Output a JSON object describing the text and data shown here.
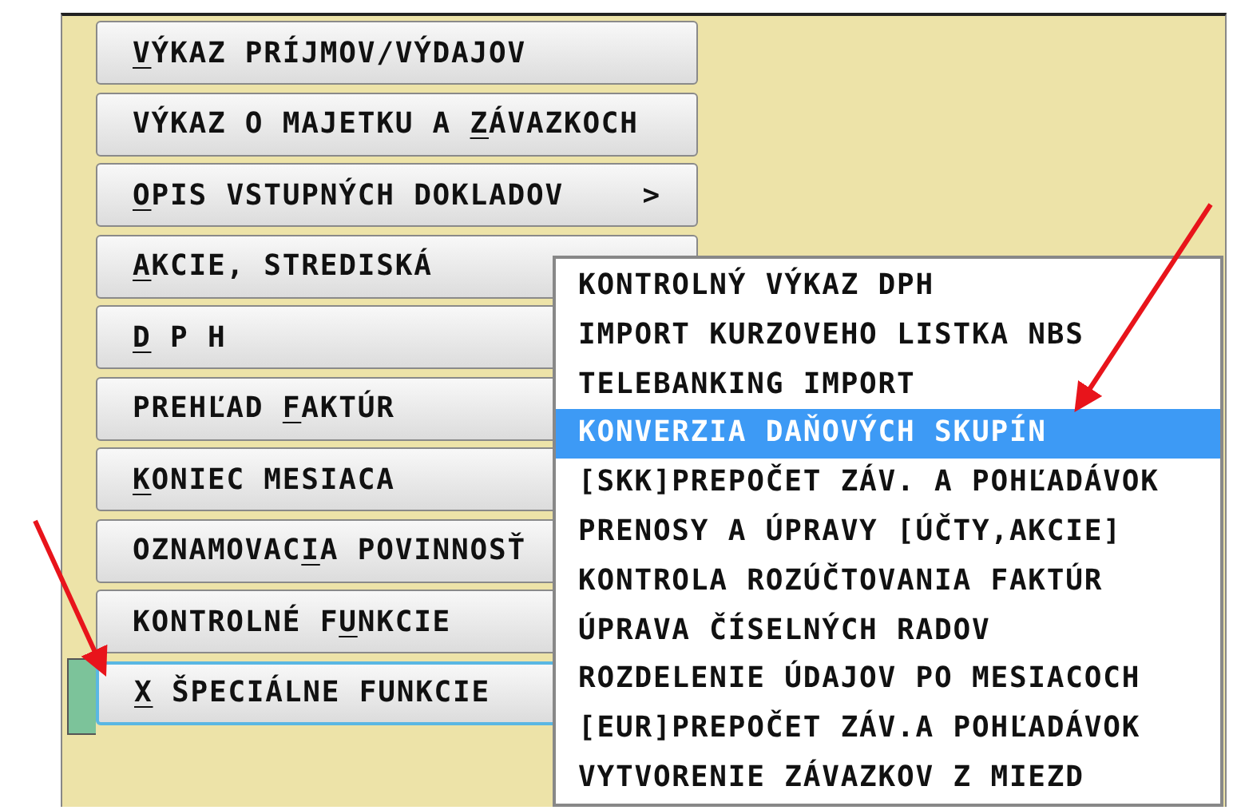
{
  "main_menu": [
    {
      "key": "V",
      "after": "ÝKAZ PRÍJMOV/VÝDAJOV",
      "selected": false
    },
    {
      "before": "VÝKAZ O MAJETKU A ",
      "key": "Z",
      "after": "ÁVAZKOCH",
      "selected": false
    },
    {
      "key": "O",
      "after": "PIS VSTUPNÝCH DOKLADOV",
      "submenu_mark": ">",
      "selected": false
    },
    {
      "key": "A",
      "after": "KCIE, STREDISKÁ",
      "selected": false
    },
    {
      "key": "D",
      "after": " P H",
      "selected": false
    },
    {
      "before": "PREHĽAD ",
      "key": "F",
      "after": "AKTÚR",
      "selected": false
    },
    {
      "key": "K",
      "after": "ONIEC MESIACA",
      "selected": false
    },
    {
      "before": "OZNAMOVAC",
      "key": "I",
      "after": "A POVINNOSŤ",
      "selected": false
    },
    {
      "before": "KONTROLNÉ F",
      "key": "U",
      "after": "NKCIE",
      "selected": false
    },
    {
      "key": "X",
      "after": " ŠPECIÁLNE FUNKCIE",
      "selected": true
    }
  ],
  "submenu": [
    {
      "label": "KONTROLNÝ VÝKAZ DPH",
      "selected": false
    },
    {
      "label": "IMPORT KURZOVEHO LISTKA NBS",
      "selected": false
    },
    {
      "label": "TELEBANKING IMPORT",
      "selected": false
    },
    {
      "label": "KONVERZIA DAŇOVÝCH SKUPÍN",
      "selected": true
    },
    {
      "label": "[SKK]PREPOČET ZÁV. A POHĽADÁVOK",
      "selected": false
    },
    {
      "label": "PRENOSY A ÚPRAVY [ÚČTY,AKCIE]",
      "selected": false
    },
    {
      "label": "KONTROLA ROZÚČTOVANIA FAKTÚR",
      "selected": false
    },
    {
      "label": "ÚPRAVA ČÍSELNÝCH RADOV",
      "selected": false
    },
    {
      "label": "ROZDELENIE ÚDAJOV PO MESIACOCH",
      "selected": false
    },
    {
      "label": "[EUR]PREPOČET ZÁV.A POHĽADÁVOK",
      "selected": false
    },
    {
      "label": "VYTVORENIE ZÁVAZKOV Z MIEZD",
      "selected": false
    }
  ]
}
